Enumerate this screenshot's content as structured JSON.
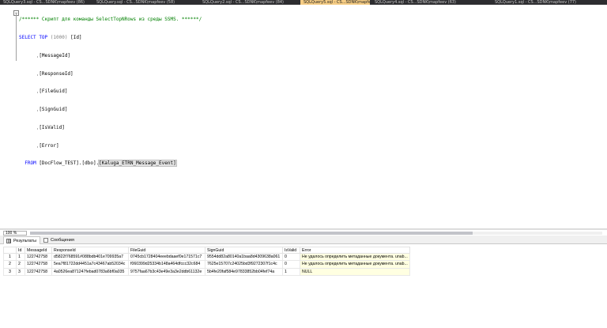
{
  "tabs": [
    {
      "label": "SQLQuery3.sql - CS...SDNK\\mapfeev (86)"
    },
    {
      "label": "SQLQuery.sql - CS...SDNK\\mapfeev (58)"
    },
    {
      "label": "SQLQuery2.sql - CS...SDNK\\mapfeev (84)"
    },
    {
      "label": "SQLQuery5.sql - CS...SDNK\\mapfeev (60)",
      "active": true
    },
    {
      "label": "SQLQuery4.sql - CS...SDNK\\mapfeev (63)"
    },
    {
      "label": "SQLQuery1.sql - CS...SDNK\\mapfeev (77)"
    }
  ],
  "editor": {
    "comment": "/****** Скрипт для команды SelectTopNRows из среды SSMS. ******/",
    "select_kw": "SELECT",
    "top_kw": "TOP",
    "top_value": "(1000)",
    "col_id": "[Id]",
    "col_messageid": "[MessageId]",
    "col_responseid": "[ResponseId]",
    "col_fileguid": "[FileGuid]",
    "col_signguid": "[SignGuid]",
    "col_isvalid": "[IsValid]",
    "col_error": "[Error]",
    "from_kw": "FROM",
    "from_db": "[DocFlow_TEST].[dbo].",
    "from_table": "[Kaluga_ETRN_Message_Event]",
    "comma": ","
  },
  "zoom": "100 %",
  "results_tabs": {
    "results": "Результаты",
    "messages": "Сообщения"
  },
  "grid": {
    "columns": [
      "Id",
      "MessageId",
      "ResponseId",
      "FileGuid",
      "SignGuid",
      "IsValid",
      "Error"
    ],
    "rows": [
      {
        "n": "1",
        "cells": [
          "1",
          "122742758",
          "d5822f768591#088bdb401e709935a7",
          "0745cb1728404eeebdaaef0e171571c7",
          "9554dd82a80140a1baa8d4309638a061",
          "0",
          "Не удалось определить метаданные документа. unab..."
        ]
      },
      {
        "n": "2",
        "cells": [
          "2",
          "122742758",
          "5ea7f81722dd4451a7c43467ab52034c",
          "f060399d25334b148a464dfccc32c684",
          "7625e15707c24025bd3f9272307f1c4c",
          "0",
          "Не удалось определить метаданные документа. unab..."
        ]
      },
      {
        "n": "3",
        "cells": [
          "3",
          "122742758",
          "4a0526ea871247febad0783a6bf0a035",
          "9757faa67b3c43e49e3a3e2ddb61132e",
          "5b4fe20faf584e97833852bb04fef74a",
          "1",
          "NULL"
        ]
      }
    ]
  }
}
